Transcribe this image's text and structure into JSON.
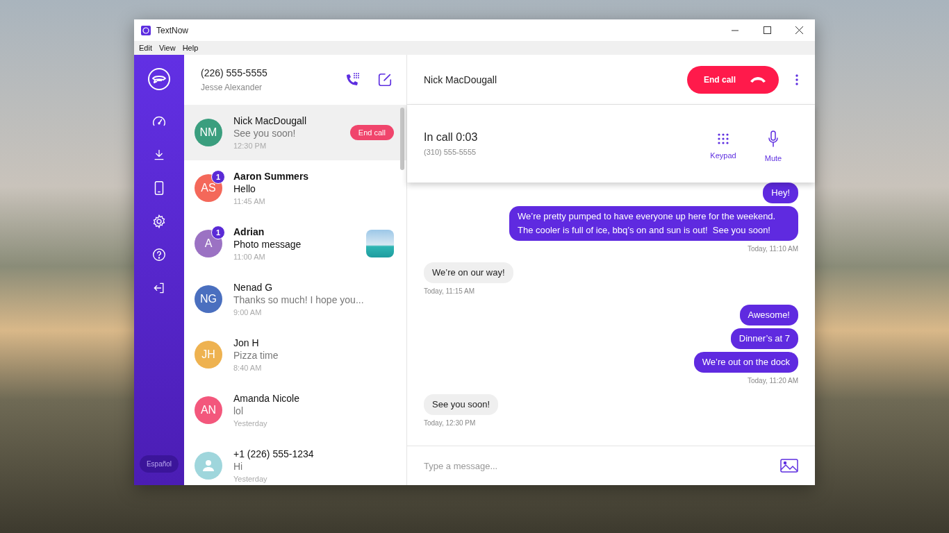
{
  "window": {
    "title": "TextNow"
  },
  "menu": [
    "Edit",
    "View",
    "Help"
  ],
  "sidebar": {
    "language_button": "Español"
  },
  "account": {
    "phone_number": "(226) 555-5555",
    "name": "Jesse Alexander"
  },
  "conversations": [
    {
      "name": "Nick MacDougall",
      "preview": "See you soon!",
      "time": "12:30 PM",
      "initials": "NM",
      "color": "#3a9e7e",
      "selected": true,
      "unread": false,
      "end_call_button": "End call"
    },
    {
      "name": "Aaron Summers",
      "preview": "Hello",
      "time": "11:45 AM",
      "initials": "AS",
      "color": "#f4685a",
      "selected": false,
      "unread": true,
      "badge": "1"
    },
    {
      "name": "Adrian",
      "preview": "Photo message",
      "time": "11:00 AM",
      "initials": "A",
      "color": "#9b72c3",
      "selected": false,
      "unread": true,
      "badge": "1",
      "photo": true
    },
    {
      "name": "Nenad G",
      "preview": "Thanks so much! I hope you...",
      "time": "9:00 AM",
      "initials": "NG",
      "color": "#4a6fbf",
      "selected": false,
      "unread": false
    },
    {
      "name": "Jon H",
      "preview": "Pizza time",
      "time": "8:40 AM",
      "initials": "JH",
      "color": "#eeb250",
      "selected": false,
      "unread": false
    },
    {
      "name": "Amanda Nicole",
      "preview": "lol",
      "time": "Yesterday",
      "initials": "AN",
      "color": "#f3577c",
      "selected": false,
      "unread": false
    },
    {
      "name": "+1 (226) 555-1234",
      "preview": "Hi",
      "time": "Yesterday",
      "color": "#9fd6dc",
      "selected": false,
      "unread": false
    }
  ],
  "chat": {
    "contact": "Nick MacDougall",
    "end_call_button": "End call",
    "call": {
      "status": "In call 0:03",
      "number": "(310) 555-5555",
      "actions": [
        {
          "kind": "keypad",
          "label": "Keypad"
        },
        {
          "kind": "mute",
          "label": "Mute"
        }
      ]
    },
    "message_groups": [
      {
        "kind": "sent",
        "messages": [
          "Hey!",
          "We’re pretty pumped to have everyone up here for the weekend. The cooler is full of ice, bbq’s on and sun is out!  See you soon!"
        ],
        "time": "Today, 11:10 AM"
      },
      {
        "kind": "received",
        "messages": [
          "We’re on our way!"
        ],
        "time": "Today, 11:15 AM"
      },
      {
        "kind": "sent",
        "messages": [
          "Awesome!",
          "Dinner’s at 7",
          "We’re out on the dock"
        ],
        "time": "Today, 11:20 AM"
      },
      {
        "kind": "received",
        "messages": [
          "See you soon!"
        ],
        "time": "Today, 12:30 PM"
      }
    ],
    "composer": {
      "placeholder": "Type a message..."
    }
  }
}
